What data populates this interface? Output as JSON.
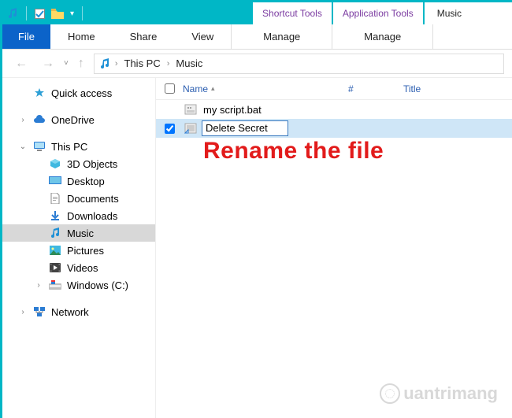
{
  "titlebar": {
    "contextual_tabs": [
      "Shortcut Tools",
      "Application Tools"
    ],
    "window_title": "Music"
  },
  "ribbon": {
    "file": "File",
    "tabs": [
      "Home",
      "Share",
      "View"
    ],
    "context_tabs": [
      "Manage",
      "Manage"
    ]
  },
  "breadcrumb": {
    "items": [
      "This PC",
      "Music"
    ]
  },
  "columns": {
    "name": "Name",
    "hash": "#",
    "title": "Title"
  },
  "files": [
    {
      "name": "my script.bat",
      "selected": false,
      "renaming": false
    },
    {
      "name": "Delete Secret",
      "selected": true,
      "renaming": true
    }
  ],
  "sidebar": {
    "quick_access": "Quick access",
    "onedrive": "OneDrive",
    "this_pc": "This PC",
    "this_pc_children": [
      "3D Objects",
      "Desktop",
      "Documents",
      "Downloads",
      "Music",
      "Pictures",
      "Videos",
      "Windows (C:)"
    ],
    "network": "Network"
  },
  "annotation": "Rename the file",
  "watermark": "uantrimang"
}
